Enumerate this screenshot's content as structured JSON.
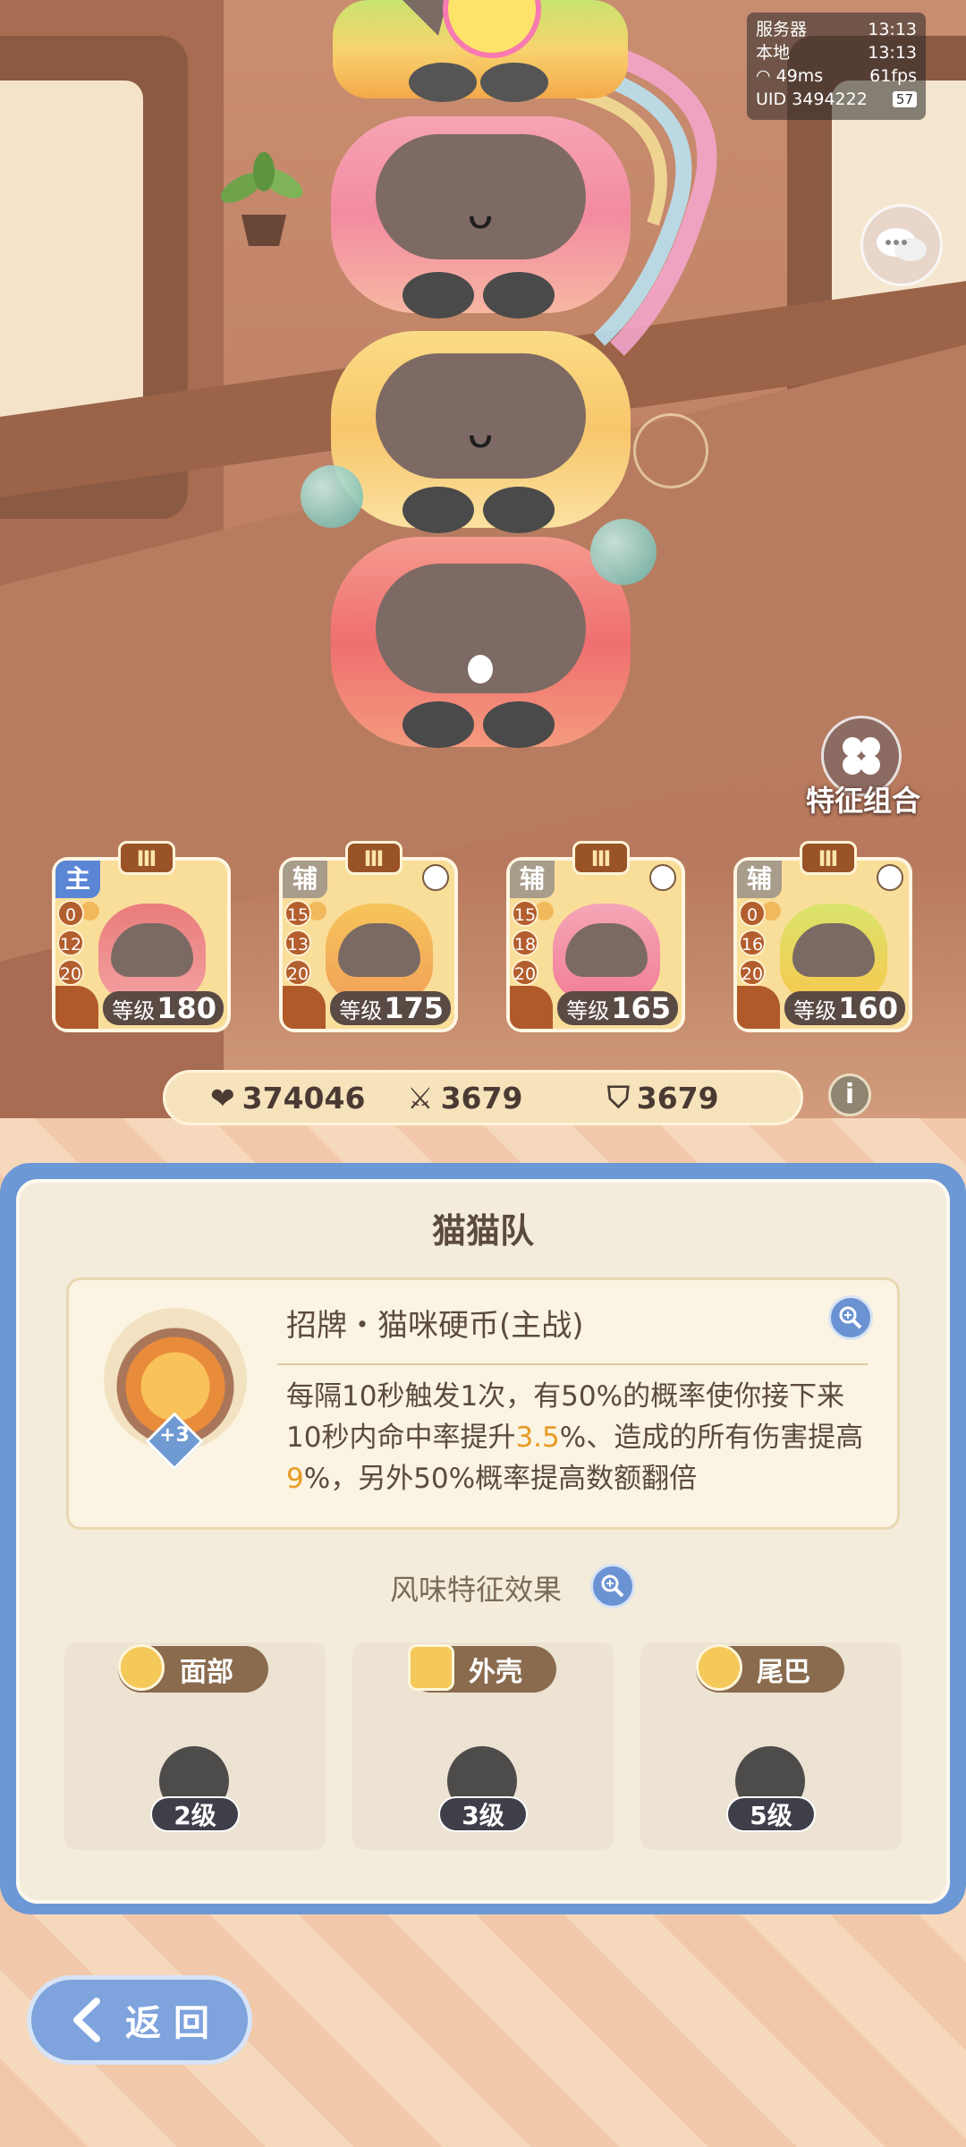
{
  "hud": {
    "server_label": "服务器",
    "server_time": "13:13",
    "local_label": "本地",
    "local_time": "13:13",
    "ping": "49ms",
    "fps": "61fps",
    "uid_label": "UID",
    "uid_value": "3494222",
    "battery": "57"
  },
  "traits_button": {
    "label": "特征组合"
  },
  "team": [
    {
      "role": "主",
      "tier": "Ⅲ",
      "stats": [
        "0",
        "12",
        "20"
      ],
      "level_label": "等级",
      "level": "180",
      "locked": false,
      "role_color": "#5b86d6"
    },
    {
      "role": "辅",
      "tier": "Ⅲ",
      "stats": [
        "15",
        "13",
        "20"
      ],
      "level_label": "等级",
      "level": "175",
      "locked": true,
      "role_color": "#a89c8a"
    },
    {
      "role": "辅",
      "tier": "Ⅲ",
      "stats": [
        "15",
        "18",
        "20"
      ],
      "level_label": "等级",
      "level": "165",
      "locked": true,
      "role_color": "#a89c8a"
    },
    {
      "role": "辅",
      "tier": "Ⅲ",
      "stats": [
        "0",
        "16",
        "20"
      ],
      "level_label": "等级",
      "level": "160",
      "locked": true,
      "role_color": "#a89c8a"
    }
  ],
  "totals": {
    "hp": "374046",
    "attack": "3679",
    "defense": "3679"
  },
  "panel": {
    "title": "猫猫队",
    "skill": {
      "name": "招牌・猫咪硬币(主战)",
      "badge": "+3",
      "desc_parts": [
        "每隔10秒触发1次，有50%的概率使你接下来10秒内命中率提升",
        "3.5",
        "%、造成的所有伤害提高",
        "9",
        "%，另外50%概率提高数额翻倍"
      ]
    },
    "flavor_title": "风味特征效果",
    "flavors": [
      {
        "name": "面部",
        "level": "2级"
      },
      {
        "name": "外壳",
        "level": "3级"
      },
      {
        "name": "尾巴",
        "level": "5级"
      }
    ]
  },
  "back_button": {
    "label": "返 回"
  }
}
